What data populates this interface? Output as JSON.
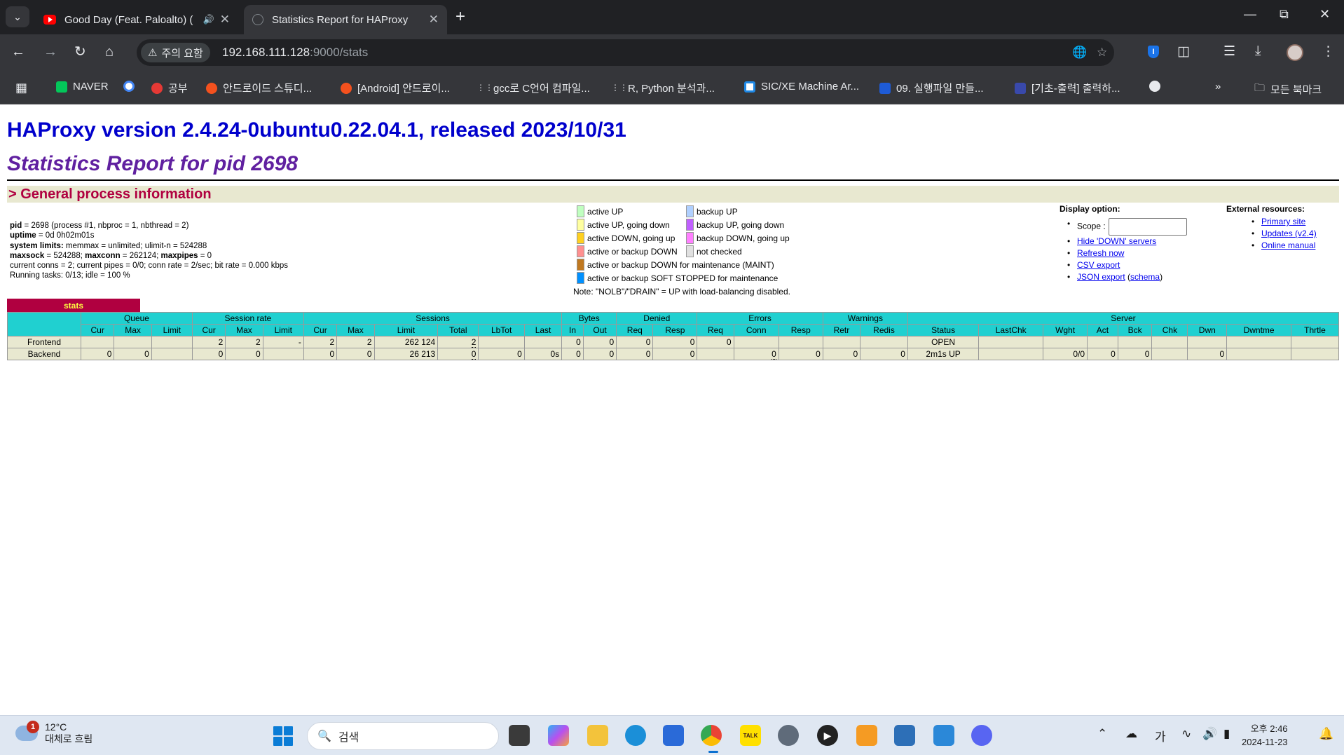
{
  "browser": {
    "tabs": [
      {
        "title": "Good Day (Feat. Paloalto) (",
        "icon": "youtube-icon"
      },
      {
        "title": "Statistics Report for HAProxy",
        "icon": "globe-icon"
      }
    ],
    "security_chip": "주의 요함",
    "url_host": "192.168.111.128",
    "url_path": ":9000/stats",
    "bookmarks": [
      "NAVER",
      "공부",
      "안드로이드 스튜디...",
      "[Android] 안드로이...",
      "gcc로 C언어 컴파일...",
      "R, Python 분석과...",
      "SIC/XE Machine Ar...",
      "09. 실행파일 만들...",
      "[기초-출력] 출력하...",
      "모든 북마크"
    ]
  },
  "page": {
    "title": "HAProxy version 2.4.24-0ubuntu0.22.04.1, released 2023/10/31",
    "subtitle": "Statistics Report for pid 2698",
    "section_header": "> General process information",
    "process_info": [
      {
        "label": "pid",
        "value": " = 2698 (process #1, nbproc = 1, nbthread = 2)"
      },
      {
        "label": "uptime",
        "value": " = 0d 0h02m01s"
      },
      {
        "label": "system limits:",
        "value": " memmax = unlimited; ulimit-n = 524288"
      },
      {
        "label": "maxsock",
        "value": " = 524288; "
      },
      {
        "label": "",
        "value": "current conns = 2; current pipes = 0/0; conn rate = 2/sec; bit rate = 0.000 kbps"
      },
      {
        "label": "",
        "value": "Running tasks: 0/13; idle = 100 %"
      }
    ],
    "maxsock_line": {
      "maxconn_label": "maxconn",
      "maxconn_value": " = 262124; ",
      "maxpipes_label": "maxpipes",
      "maxpipes_value": " = 0"
    },
    "legend": [
      {
        "label": "active UP",
        "color": "#c0ffc0"
      },
      {
        "label": "active UP, going down",
        "color": "#ffffa0"
      },
      {
        "label": "active DOWN, going up",
        "color": "#ffd020"
      },
      {
        "label": "active or backup DOWN",
        "color": "#ff9090"
      },
      {
        "label": "active or backup DOWN for maintenance (MAINT)",
        "color": "#c07820"
      },
      {
        "label": "active or backup SOFT STOPPED for maintenance",
        "color": "#0090ff"
      },
      {
        "label": "backup UP",
        "color": "#b0d0ff"
      },
      {
        "label": "backup UP, going down",
        "color": "#c060ff"
      },
      {
        "label": "backup DOWN, going up",
        "color": "#ff80ff"
      },
      {
        "label": "not checked",
        "color": "#e0e0e0"
      }
    ],
    "legend_note": "Note: \"NOLB\"/\"DRAIN\" = UP with load-balancing disabled.",
    "display_option": {
      "header": "Display option:",
      "scope_label": "Scope :",
      "links": [
        "Hide 'DOWN' servers",
        "Refresh now",
        "CSV export",
        "JSON export"
      ],
      "schema_link": "schema"
    },
    "external": {
      "header": "External resources:",
      "links": [
        "Primary site",
        "Updates (v2.4)",
        "Online manual"
      ]
    },
    "proxy_name": "stats",
    "table": {
      "groups": [
        "",
        "Queue",
        "Session rate",
        "Sessions",
        "Bytes",
        "Denied",
        "Errors",
        "Warnings",
        "Server"
      ],
      "subheaders": [
        "Cur",
        "Max",
        "Limit",
        "Cur",
        "Max",
        "Limit",
        "Cur",
        "Max",
        "Limit",
        "Total",
        "LbTot",
        "Last",
        "In",
        "Out",
        "Req",
        "Resp",
        "Req",
        "Conn",
        "Resp",
        "Retr",
        "Redis",
        "Status",
        "LastChk",
        "Wght",
        "Act",
        "Bck",
        "Chk",
        "Dwn",
        "Dwntme",
        "Thrtle"
      ],
      "rows": [
        [
          "Frontend",
          "",
          "",
          "",
          "2",
          "2",
          "-",
          "2",
          "2",
          "262 124",
          "2",
          "",
          "",
          "0",
          "0",
          "0",
          "0",
          "0",
          "",
          "",
          "",
          "",
          "OPEN",
          "",
          "",
          "",
          "",
          "",
          "",
          "",
          ""
        ],
        [
          "Backend",
          "0",
          "0",
          "",
          "0",
          "0",
          "",
          "0",
          "0",
          "26 213",
          "0",
          "0",
          "0s",
          "0",
          "0",
          "0",
          "0",
          "",
          "0",
          "0",
          "0",
          "0",
          "2m1s UP",
          "",
          "0/0",
          "0",
          "0",
          "",
          "0",
          "",
          ""
        ]
      ]
    }
  },
  "taskbar": {
    "weather_temp": "12°C",
    "weather_desc": "대체로 흐림",
    "weather_badge": "1",
    "search_placeholder": "검색",
    "ime": "가",
    "time": "오후 2:46",
    "date": "2024-11-23"
  }
}
